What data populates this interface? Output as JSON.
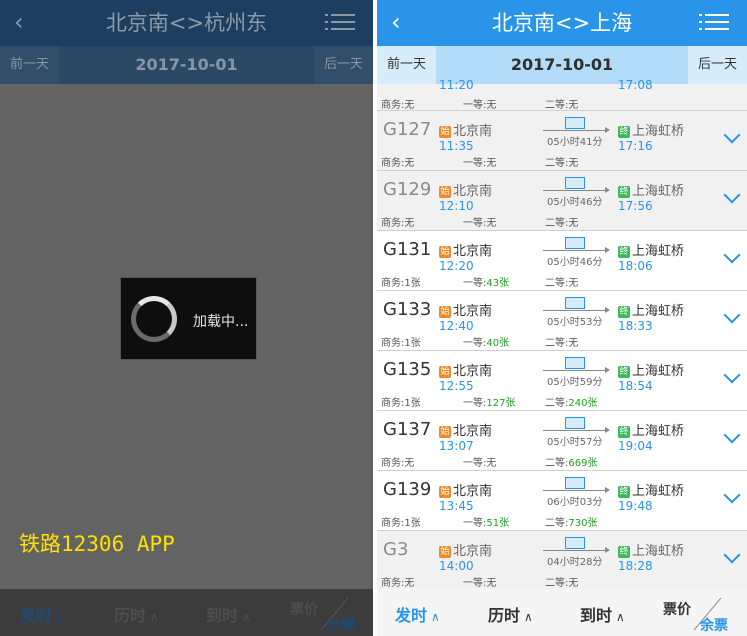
{
  "left": {
    "header": {
      "back_icon": "chevron-left-icon",
      "title": "北京南<>杭州东",
      "menu_icon": "list-menu-icon"
    },
    "datebar": {
      "prev": "前一天",
      "date": "2017-10-01",
      "next": "后一天"
    },
    "loading": {
      "text": "加载中..."
    },
    "watermark": "铁路12306 APP",
    "sort": {
      "depart": "发时",
      "duration": "历时",
      "arrive": "到时",
      "price": "票价",
      "remaining": "余票"
    }
  },
  "right": {
    "header": {
      "back_icon": "chevron-left-icon",
      "title": "北京南<>上海",
      "menu_icon": "list-menu-icon"
    },
    "datebar": {
      "prev": "前一天",
      "date": "2017-10-01",
      "next": "后一天"
    },
    "partial_row": {
      "dep_time": "11:20",
      "arr_time": "17:08",
      "biz": "商务:无",
      "first": "一等:无",
      "second": "二等:无"
    },
    "trains": [
      {
        "code": "G127",
        "from": "北京南",
        "dep_time": "11:35",
        "duration": "05小时41分",
        "to": "上海虹桥",
        "arr_time": "17:16",
        "biz": "商务:无",
        "first": "一等:无",
        "second": "二等:无",
        "muted": true
      },
      {
        "code": "G129",
        "from": "北京南",
        "dep_time": "12:10",
        "duration": "05小时46分",
        "to": "上海虹桥",
        "arr_time": "17:56",
        "biz": "商务:无",
        "first": "一等:无",
        "second": "二等:无",
        "muted": true
      },
      {
        "code": "G131",
        "from": "北京南",
        "dep_time": "12:20",
        "duration": "05小时46分",
        "to": "上海虹桥",
        "arr_time": "18:06",
        "biz": "商务:1张",
        "first_label": "一等:",
        "first_val": "43张",
        "second": "二等:无",
        "muted": false
      },
      {
        "code": "G133",
        "from": "北京南",
        "dep_time": "12:40",
        "duration": "05小时53分",
        "to": "上海虹桥",
        "arr_time": "18:33",
        "biz": "商务:1张",
        "first_label": "一等:",
        "first_val": "40张",
        "second": "二等:无",
        "muted": false
      },
      {
        "code": "G135",
        "from": "北京南",
        "dep_time": "12:55",
        "duration": "05小时59分",
        "to": "上海虹桥",
        "arr_time": "18:54",
        "biz": "商务:1张",
        "first_label": "一等:",
        "first_val": "127张",
        "second_label": "二等:",
        "second_val": "240张",
        "muted": false
      },
      {
        "code": "G137",
        "from": "北京南",
        "dep_time": "13:07",
        "duration": "05小时57分",
        "to": "上海虹桥",
        "arr_time": "19:04",
        "biz": "商务:无",
        "first": "一等:无",
        "second_label": "二等:",
        "second_val": "669张",
        "muted": false
      },
      {
        "code": "G139",
        "from": "北京南",
        "dep_time": "13:45",
        "duration": "06小时03分",
        "to": "上海虹桥",
        "arr_time": "19:48",
        "biz": "商务:1张",
        "first_label": "一等:",
        "first_val": "51张",
        "second_label": "二等:",
        "second_val": "730张",
        "muted": false
      },
      {
        "code": "G3",
        "from": "北京南",
        "dep_time": "14:00",
        "duration": "04小时28分",
        "to": "上海虹桥",
        "arr_time": "18:28",
        "biz": "商务:无",
        "first": "一等:无",
        "second": "二等:无",
        "muted": true
      }
    ],
    "tags": {
      "start": "始",
      "end": "终"
    },
    "sort": {
      "depart": "发时",
      "duration": "历时",
      "arrive": "到时",
      "price": "票价",
      "remaining": "余票"
    }
  }
}
